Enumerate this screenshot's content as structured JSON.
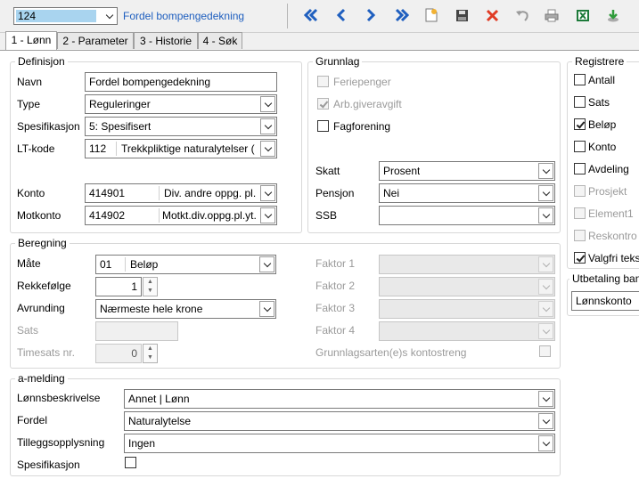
{
  "header": {
    "record_number": "124",
    "record_title": "Fordel bompengedekning"
  },
  "toolbar_icons": [
    "first-icon",
    "previous-icon",
    "next-icon",
    "last-icon",
    "new-document-icon",
    "save-icon",
    "delete-icon",
    "undo-icon",
    "print-icon",
    "excel-icon",
    "download-icon"
  ],
  "tabs": [
    {
      "label": "1 - Lønn"
    },
    {
      "label": "2 - Parameter"
    },
    {
      "label": "3 - Historie"
    },
    {
      "label": "4 - Søk"
    }
  ],
  "definisjon": {
    "title": "Definisjon",
    "navn_label": "Navn",
    "navn_value": "Fordel bompengedekning",
    "type_label": "Type",
    "type_value": "Reguleringer",
    "spes_label": "Spesifikasjon",
    "spes_value": "5:  Spesifisert",
    "ltkode_label": "LT-kode",
    "ltkode_code": "112",
    "ltkode_text": "Trekkpliktige naturalytelser (",
    "konto_label": "Konto",
    "konto_code": "414901",
    "konto_text": "Div. andre oppg. pl.",
    "motkonto_label": "Motkonto",
    "motkonto_code": "414902",
    "motkonto_text": "Motkt.div.oppg.pl.yt."
  },
  "grunnlag": {
    "title": "Grunnlag",
    "feriepenger": "Feriepenger",
    "arbgiveravgift": "Arb.giveravgift",
    "fagforening": "Fagforening",
    "skatt_label": "Skatt",
    "skatt_value": "Prosent",
    "pensjon_label": "Pensjon",
    "pensjon_value": "Nei",
    "ssb_label": "SSB",
    "ssb_value": ""
  },
  "registrere": {
    "title": "Registrere",
    "items": [
      {
        "label": "Antall",
        "checked": false,
        "enabled": true
      },
      {
        "label": "Sats",
        "checked": false,
        "enabled": true
      },
      {
        "label": "Beløp",
        "checked": true,
        "enabled": true
      },
      {
        "label": "Konto",
        "checked": false,
        "enabled": true
      },
      {
        "label": "Avdeling",
        "checked": false,
        "enabled": true
      },
      {
        "label": "Prosjekt",
        "checked": false,
        "enabled": false
      },
      {
        "label": "Element1",
        "checked": false,
        "enabled": false
      },
      {
        "label": "Reskontro",
        "checked": false,
        "enabled": false
      },
      {
        "label": "Valgfri tekst",
        "checked": true,
        "enabled": true
      }
    ]
  },
  "utbetaling": {
    "title": "Utbetaling bank",
    "value": "Lønnskonto"
  },
  "beregning": {
    "title": "Beregning",
    "mate_label": "Måte",
    "mate_code": "01",
    "mate_text": "Beløp",
    "rekkefolge_label": "Rekkefølge",
    "rekkefolge_value": "1",
    "avrunding_label": "Avrunding",
    "avrunding_value": "Nærmeste hele krone",
    "sats_label": "Sats",
    "sats_value": "",
    "timesats_label": "Timesats nr.",
    "timesats_value": "0",
    "faktor1": "Faktor 1",
    "faktor2": "Faktor 2",
    "faktor3": "Faktor 3",
    "faktor4": "Faktor 4",
    "grunnlagsart": "Grunnlagsarten(e)s kontostreng"
  },
  "amelding": {
    "title": "a-melding",
    "lonnsbeskrivelse_label": "Lønnsbeskrivelse",
    "lonnsbeskrivelse_value": "Annet | Lønn",
    "fordel_label": "Fordel",
    "fordel_value": "Naturalytelse",
    "tillegg_label": "Tilleggsopplysning",
    "tillegg_value": "Ingen",
    "spes_label": "Spesifikasjon"
  },
  "colors": {
    "accent_blue": "#1f5fbf",
    "selection_bg": "#a9d4ef",
    "delete_red": "#e03b24",
    "excel_green": "#1d7a3a"
  }
}
